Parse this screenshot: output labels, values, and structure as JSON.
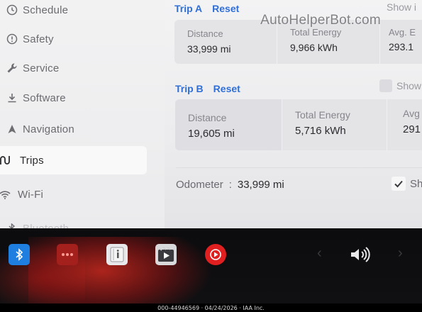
{
  "sidebar": {
    "items": [
      {
        "label": "Schedule",
        "icon": "clock-icon"
      },
      {
        "label": "Safety",
        "icon": "alert-circle-icon"
      },
      {
        "label": "Service",
        "icon": "wrench-icon"
      },
      {
        "label": "Software",
        "icon": "download-icon"
      },
      {
        "label": "Navigation",
        "icon": "navigation-arrow-icon"
      },
      {
        "label": "Trips",
        "icon": "trips-icon",
        "active": true
      },
      {
        "label": "Wi-Fi",
        "icon": "wifi-icon"
      },
      {
        "label": "Bluetooth",
        "icon": "bluetooth-icon"
      }
    ]
  },
  "trip_a": {
    "title": "Trip A",
    "reset_label": "Reset",
    "show_label": "Show i",
    "distance_label": "Distance",
    "distance_value": "33,999 mi",
    "energy_label": "Total Energy",
    "energy_value": "9,966 kWh",
    "avg_label": "Avg. E",
    "avg_value": "293.1"
  },
  "trip_b": {
    "title": "Trip B",
    "reset_label": "Reset",
    "show_label": "Show",
    "distance_label": "Distance",
    "distance_value": "19,605 mi",
    "energy_label": "Total Energy",
    "energy_value": "5,716 kWh",
    "avg_label": "Avg",
    "avg_value": "291"
  },
  "odometer": {
    "label": "Odometer",
    "separator": ":",
    "value": "33,999 mi",
    "show_label": "Sh"
  },
  "watermark": "AutoHelperBot.com",
  "taskbar": {
    "icons": [
      "bluetooth-icon",
      "more-apps-icon",
      "manual-icon",
      "media-player-icon",
      "youtube-music-icon",
      "chevron-left-icon",
      "volume-icon",
      "chevron-right-icon"
    ]
  },
  "footer": "000-44946569 · 04/24/2026 · IAA Inc.",
  "colors": {
    "accent_blue": "#2f6fd6",
    "bluetooth_blue": "#1e7fe0",
    "music_red": "#e02020"
  }
}
